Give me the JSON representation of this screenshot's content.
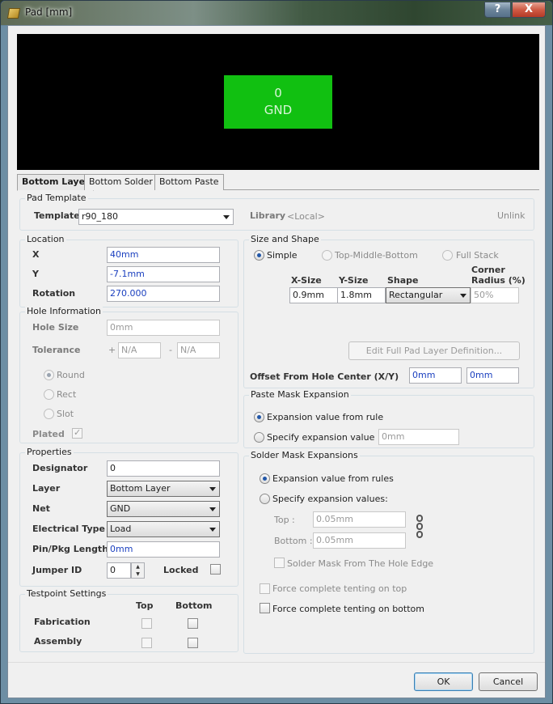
{
  "window": {
    "title": "Pad [mm]",
    "help": "?",
    "close": "X"
  },
  "preview": {
    "pad_number": "0",
    "pad_net": "GND",
    "pad_color": "#11c011"
  },
  "tabs": [
    "Bottom Layer",
    "Bottom Solder",
    "Bottom Paste"
  ],
  "pad_template": {
    "title": "Pad Template",
    "template_label": "Template",
    "template_value": "r90_180",
    "library_label": "Library",
    "library_value": "<Local>",
    "unlink": "Unlink"
  },
  "location": {
    "title": "Location",
    "x_label": "X",
    "x": "40mm",
    "y_label": "Y",
    "y": "-7.1mm",
    "rotation_label": "Rotation",
    "rotation": "270.000"
  },
  "hole": {
    "title": "Hole Information",
    "size_label": "Hole Size",
    "size": "0mm",
    "tol_label": "Tolerance",
    "plus": "+",
    "minus": "-",
    "tol_plus": "N/A",
    "tol_minus": "N/A",
    "round": "Round",
    "rect": "Rect",
    "slot": "Slot",
    "plated": "Plated"
  },
  "properties": {
    "title": "Properties",
    "designator_label": "Designator",
    "designator": "0",
    "layer_label": "Layer",
    "layer": "Bottom Layer",
    "net_label": "Net",
    "net": "GND",
    "etype_label": "Electrical Type",
    "etype": "Load",
    "pinpkg_label": "Pin/Pkg Length",
    "pinpkg": "0mm",
    "jumper_label": "Jumper ID",
    "jumper": "0",
    "locked_label": "Locked"
  },
  "testpoint": {
    "title": "Testpoint Settings",
    "top": "Top",
    "bottom": "Bottom",
    "fabrication": "Fabrication",
    "assembly": "Assembly"
  },
  "size_shape": {
    "title": "Size and Shape",
    "simple": "Simple",
    "tmb": "Top-Middle-Bottom",
    "full_stack": "Full Stack",
    "xsize_h": "X-Size",
    "ysize_h": "Y-Size",
    "shape_h": "Shape",
    "corner_h1": "Corner",
    "corner_h2": "Radius (%)",
    "xsize": "0.9mm",
    "ysize": "1.8mm",
    "shape": "Rectangular",
    "corner": "50%",
    "edit_btn": "Edit Full Pad Layer Definition...",
    "offset_label": "Offset From Hole Center (X/Y)",
    "offset_x": "0mm",
    "offset_y": "0mm"
  },
  "paste": {
    "title": "Paste Mask Expansion",
    "from_rule": "Expansion value from rule",
    "specify": "Specify expansion value",
    "value": "0mm"
  },
  "solder": {
    "title": "Solder Mask Expansions",
    "from_rules": "Expansion value from rules",
    "specify": "Specify expansion values:",
    "top_label": "Top :",
    "top": "0.05mm",
    "bottom_label": "Bottom :",
    "bottom": "0.05mm",
    "from_hole": "Solder Mask From The Hole Edge",
    "tent_top": "Force complete tenting on top",
    "tent_bottom": "Force complete tenting on bottom"
  },
  "footer": {
    "ok": "OK",
    "cancel": "Cancel"
  }
}
